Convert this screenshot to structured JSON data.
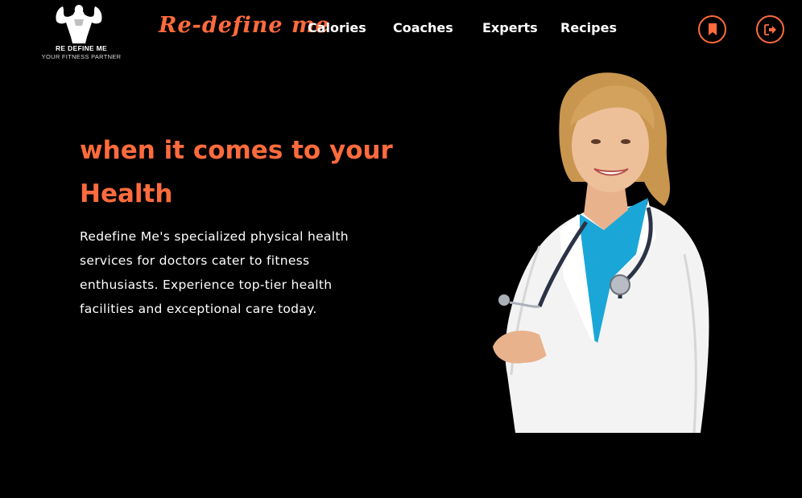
{
  "header": {
    "logo": {
      "line1": "RE DEFINE ME",
      "line2": "YOUR FITNESS PARTNER",
      "icon": "bodybuilder-logo-icon"
    },
    "brand": "Re-define me",
    "nav": [
      {
        "label": "Calories"
      },
      {
        "label": "Coaches"
      },
      {
        "label": "Experts"
      },
      {
        "label": "Recipes"
      }
    ],
    "actions": [
      {
        "icon": "bookmark-icon"
      },
      {
        "icon": "sign-out-icon"
      }
    ]
  },
  "hero": {
    "title_line1": "when it comes to your",
    "title_line2": "Health",
    "description": "Redefine Me's specialized physical health services for doctors cater to fitness enthusiasts. Experience top-tier health facilities and exceptional care today.",
    "image": "doctor-photo"
  },
  "colors": {
    "accent": "#ff6b3d",
    "background": "#000000",
    "text": "#ffffff"
  }
}
